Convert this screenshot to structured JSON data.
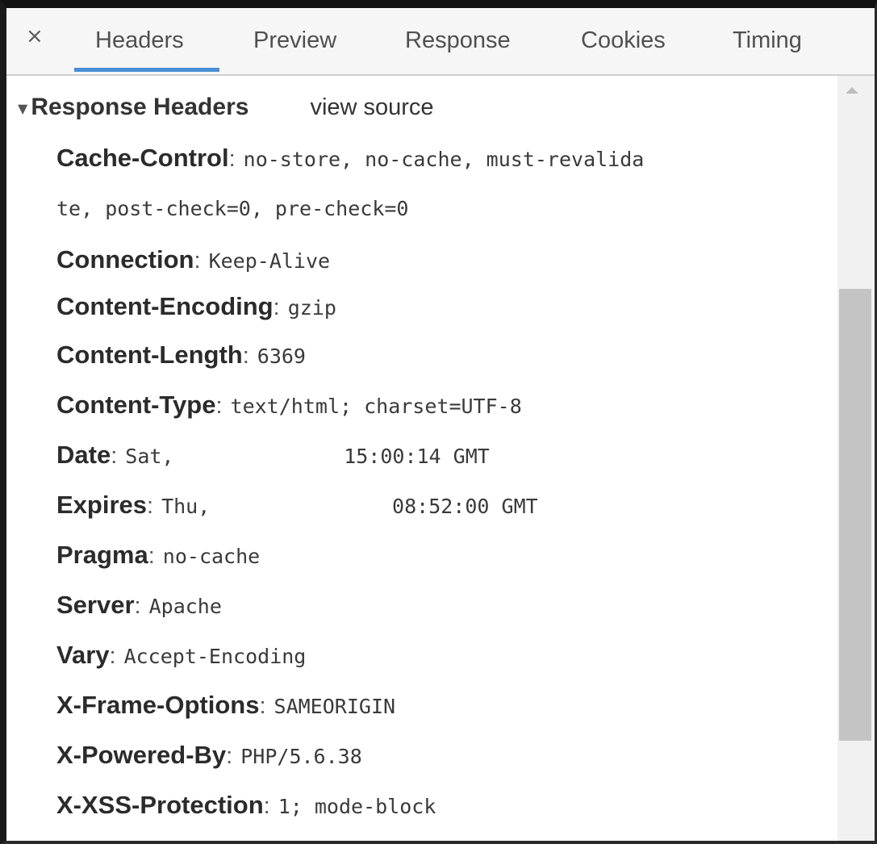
{
  "panel": {
    "close_glyph": "×",
    "tabs": [
      {
        "label": "Headers",
        "active": true
      },
      {
        "label": "Preview",
        "active": false
      },
      {
        "label": "Response",
        "active": false
      },
      {
        "label": "Cookies",
        "active": false
      },
      {
        "label": "Timing",
        "active": false
      }
    ],
    "accent_color": "#4a8fd6"
  },
  "response_headers": {
    "title": "Response Headers",
    "view_source": "view source",
    "collapse_glyph": "▼",
    "headers": [
      {
        "name": "Cache-Control",
        "value": "no-store, no-cache, must-revalida"
      },
      {
        "name": "",
        "value": "te, post-check=0, pre-check=0"
      },
      {
        "name": "Connection",
        "value": "Keep-Alive"
      },
      {
        "name": "Content-Encoding",
        "value": "gzip"
      },
      {
        "name": "Content-Length",
        "value": "6369"
      },
      {
        "name": "Content-Type",
        "value": "text/html; charset=UTF-8"
      },
      {
        "name": "Date",
        "value": "Sat,              15:00:14 GMT"
      },
      {
        "name": "Expires",
        "value": "Thu,               08:52:00 GMT"
      },
      {
        "name": "Pragma",
        "value": "no-cache"
      },
      {
        "name": "Server",
        "value": "Apache"
      },
      {
        "name": "Vary",
        "value": "Accept-Encoding"
      },
      {
        "name": "X-Frame-Options",
        "value": "SAMEORIGIN"
      },
      {
        "name": "X-Powered-By",
        "value": "PHP/5.6.38"
      },
      {
        "name": "X-XSS-Protection",
        "value": "1; mode-block"
      }
    ]
  }
}
